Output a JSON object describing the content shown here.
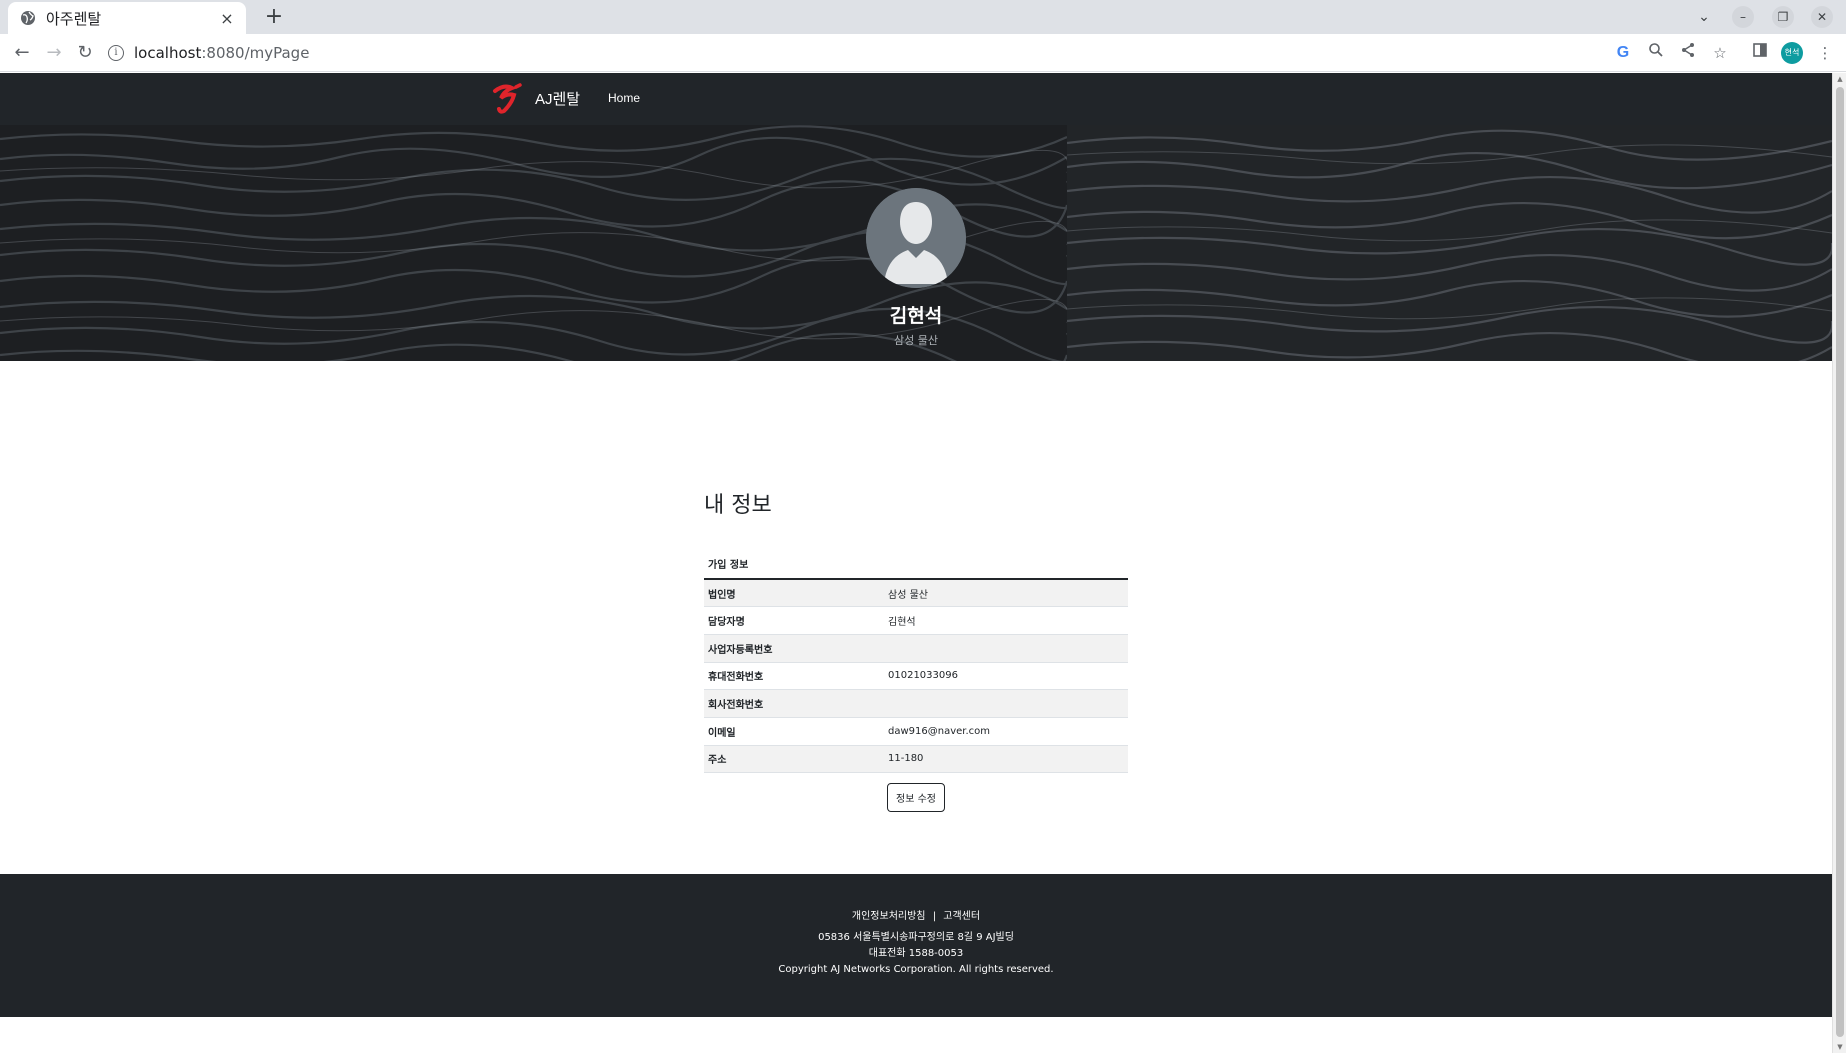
{
  "browser": {
    "tab_title": "아주렌탈",
    "tab_close": "×",
    "new_tab": "+",
    "url_host": "localhost",
    "url_path": ":8080/myPage",
    "profile_initials": "현석",
    "window_minimize": "–",
    "window_restore": "❐",
    "window_close": "✕",
    "tab_list": "⌄"
  },
  "nav": {
    "brand": "AJ렌탈",
    "home": "Home",
    "logo_color": "#e0242b"
  },
  "hero": {
    "name": "김현석",
    "company": "삼성 물산"
  },
  "mypage": {
    "title": "내 정보",
    "table_header": "가입 정보",
    "rows": [
      {
        "label": "법인명",
        "value": "삼성 물산"
      },
      {
        "label": "담당자명",
        "value": "김현석"
      },
      {
        "label": "사업자등록번호",
        "value": ""
      },
      {
        "label": "휴대전화번호",
        "value": "01021033096"
      },
      {
        "label": "회사전화번호",
        "value": ""
      },
      {
        "label": "이메일",
        "value": "daw916@naver.com"
      },
      {
        "label": "주소",
        "value": "11-180"
      }
    ],
    "edit_button": "정보 수정"
  },
  "footer": {
    "privacy": "개인정보처리방침",
    "separator": "|",
    "support": "고객센터",
    "address": "05836 서울특별시송파구정의로 8길 9 AJ빌딩",
    "phone": "대표전화 1588-0053",
    "copyright": "Copyright AJ Networks Corporation. All rights reserved."
  },
  "colors": {
    "nav_bg": "#212529",
    "footer_bg": "#212529",
    "accent": "#e0242b"
  }
}
